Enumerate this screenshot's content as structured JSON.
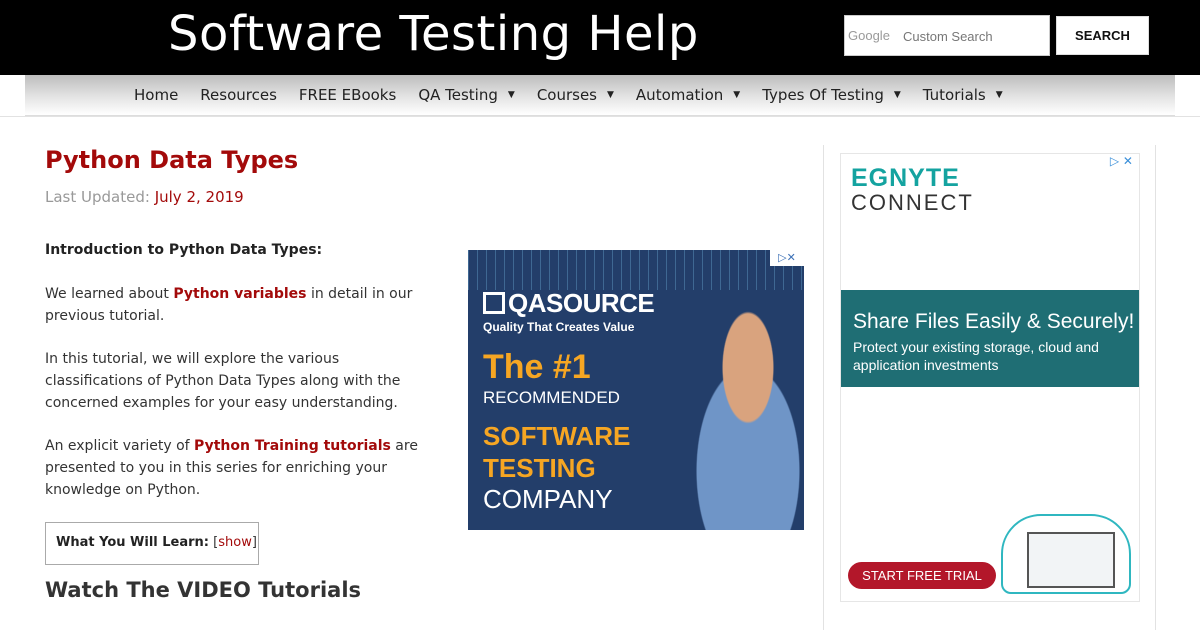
{
  "header": {
    "site_title": "Software Testing Help",
    "search": {
      "brand": "Google",
      "placeholder": "Custom Search",
      "button_label": "SEARCH"
    }
  },
  "nav": {
    "items": [
      {
        "label": "Home",
        "has_dropdown": false
      },
      {
        "label": "Resources",
        "has_dropdown": false
      },
      {
        "label": "FREE EBooks",
        "has_dropdown": false
      },
      {
        "label": "QA Testing",
        "has_dropdown": true
      },
      {
        "label": "Courses",
        "has_dropdown": true
      },
      {
        "label": "Automation",
        "has_dropdown": true
      },
      {
        "label": "Types Of Testing",
        "has_dropdown": true
      },
      {
        "label": "Tutorials",
        "has_dropdown": true
      }
    ],
    "caret_glyph": "▼"
  },
  "article": {
    "title": "Python Data Types",
    "updated_label": "Last Updated:",
    "updated_date": "July 2, 2019",
    "intro_heading": "Introduction to Python Data Types:",
    "p1_before": "We learned about ",
    "p1_link": "Python variables",
    "p1_after": " in detail in our previous tutorial.",
    "p2": "In this tutorial, we will explore the various classifications of Python Data Types along with the concerned examples for your easy understanding.",
    "p3_before": "An explicit variety of ",
    "p3_link": "Python Training tutorials",
    "p3_after": " are presented to you in this series for enriching your knowledge on Python.",
    "toc_label": "What You Will Learn:",
    "toc_open": "[",
    "toc_link": "show",
    "toc_close": "]",
    "video_heading": "Watch The VIDEO Tutorials"
  },
  "ad_inline": {
    "brand": "QASOURCE",
    "tagline": "Quality That Creates Value",
    "line1": "The #1",
    "line2": "RECOMMENDED",
    "line3a": "SOFTWARE",
    "line3b": "TESTING",
    "line4": "COMPANY",
    "adchoice": "▷✕"
  },
  "ad_sidebar": {
    "brand_top": "EGNYTE",
    "brand_bottom": "CONNECT",
    "headline": "Share Files Easily & Securely!",
    "body": "Protect your existing storage, cloud and application investments",
    "cta": "START FREE TRIAL",
    "adchoice": "▷ ✕"
  },
  "colors": {
    "header_bg": "#000000",
    "accent_red": "#a30a0a",
    "ad_navy": "#233e6a",
    "ad_orange": "#f6a623",
    "egnyte_teal": "#1f6e74",
    "cta_red": "#b3172a"
  }
}
